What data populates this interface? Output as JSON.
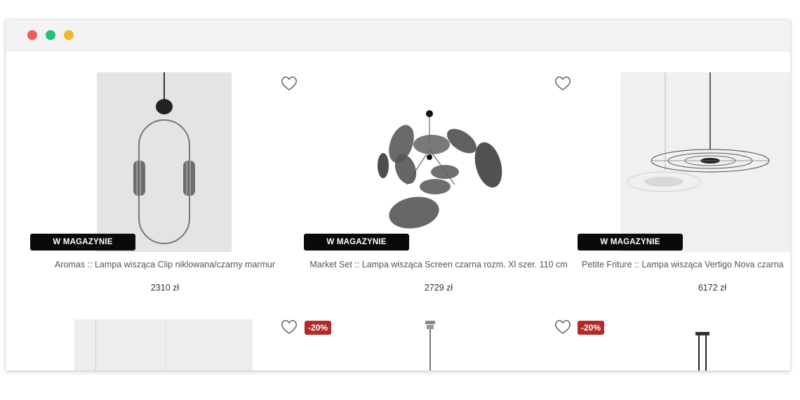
{
  "products": [
    {
      "stock_label": "W MAGAZYNIE",
      "title": "Aromas :: Lampa wisząca Clip niklowana/czarny marmur",
      "price": "2310 zł"
    },
    {
      "stock_label": "W MAGAZYNIE",
      "title": "Market Set :: Lampa wisząca Screen czarna rozm. Xl szer. 110 cm",
      "price": "2729 zł"
    },
    {
      "stock_label": "W MAGAZYNIE",
      "title": "Petite Friture :: Lampa wisząca Vertigo Nova czarna",
      "price": "6172 zł"
    }
  ],
  "row2": {
    "discount_1": "-20%",
    "discount_2": "-20%"
  },
  "colors": {
    "badge": "#0a0a0a",
    "discount": "#b22a2a",
    "close": "#f25c54",
    "minimize": "#1fc56e",
    "zoom": "#f5b52b"
  }
}
